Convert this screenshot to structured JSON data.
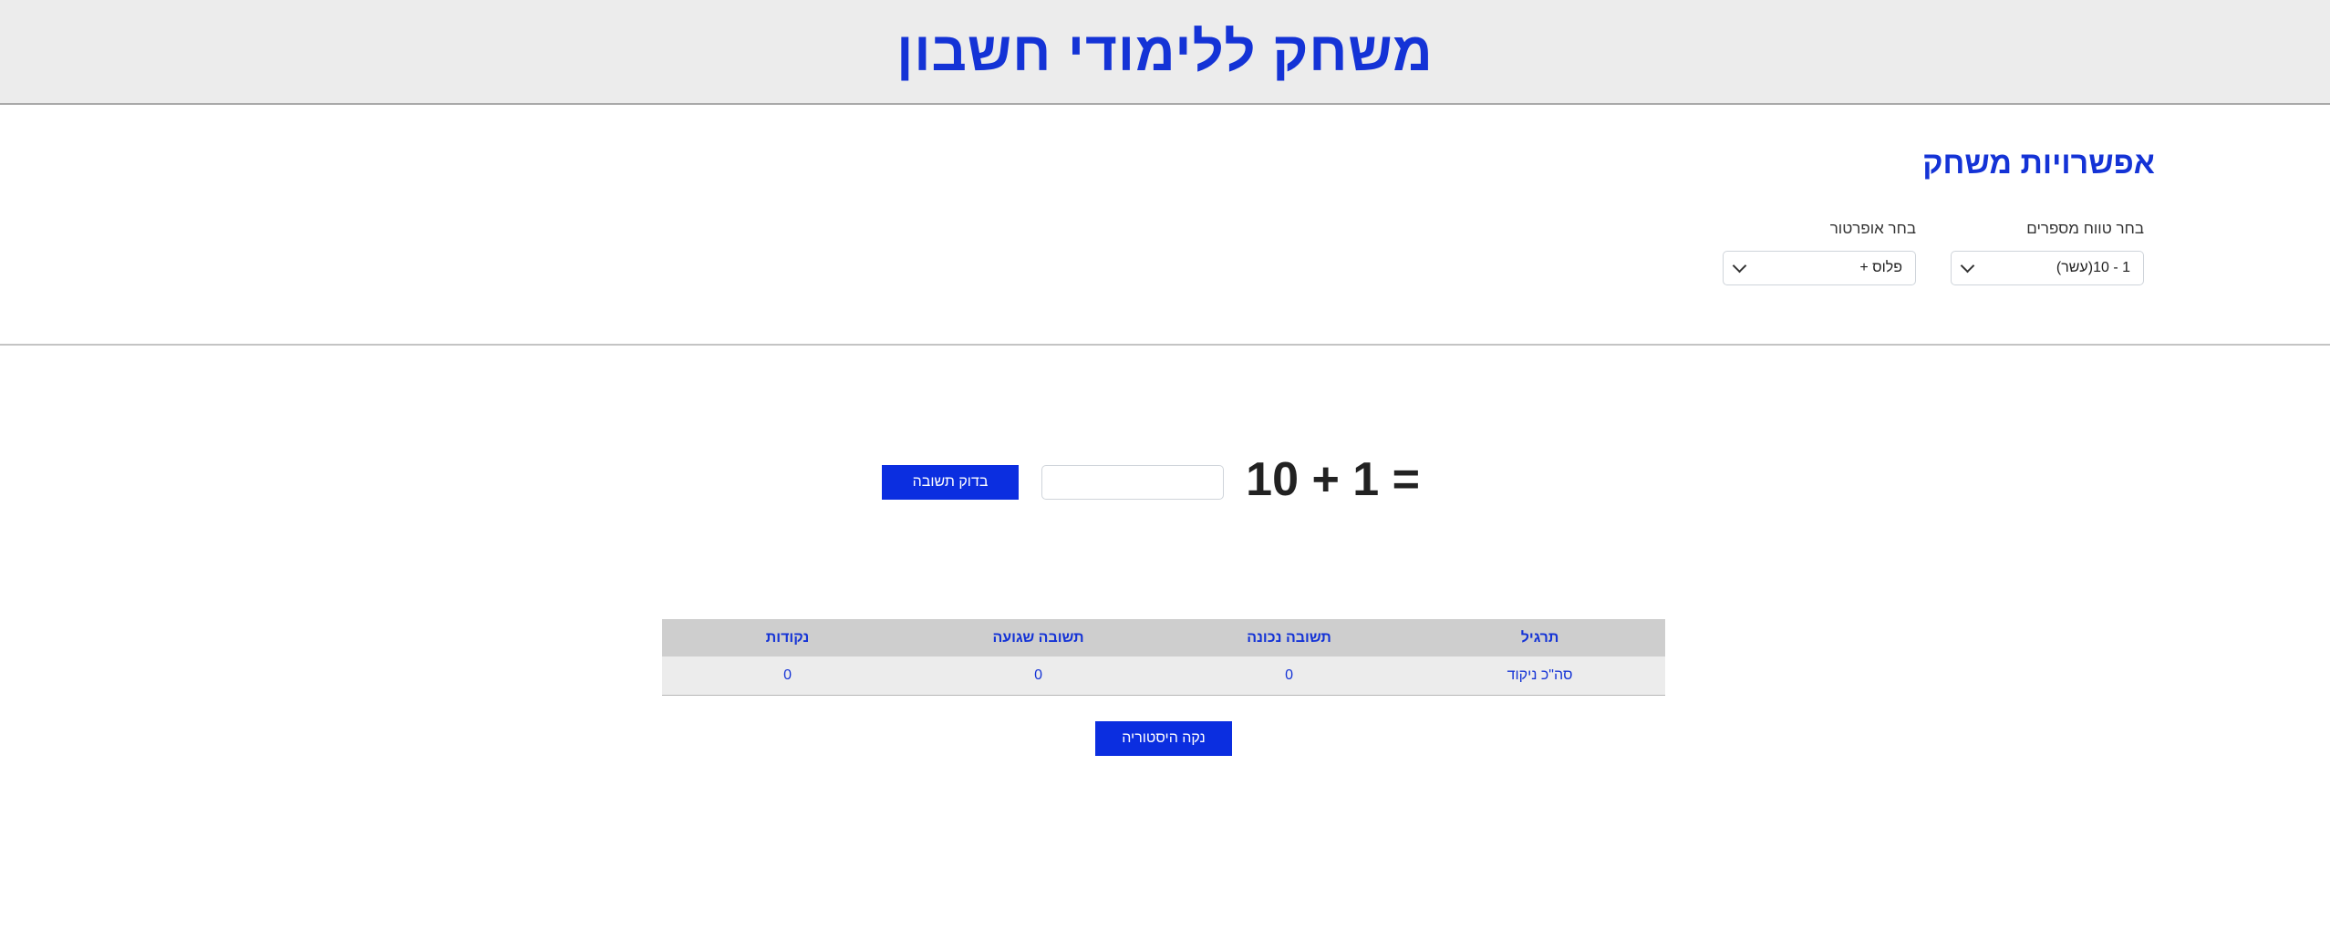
{
  "header": {
    "title": "משחק ללימודי חשבון"
  },
  "options": {
    "title": "אפשרויות משחק",
    "range": {
      "label": "בחר טווח מספרים",
      "selected": "1 - 10(עשר)"
    },
    "operator": {
      "label": "בחר אופרטור",
      "selected": "פלוס +"
    }
  },
  "exercise": {
    "expression": "10 + 1 =",
    "answer_value": "",
    "check_label": "בדוק תשובה"
  },
  "score_table": {
    "headers": [
      "תרגיל",
      "תשובה נכונה",
      "תשובה שגועה",
      "נקודות"
    ],
    "rows": [
      [
        "סה\"כ ניקוד",
        "0",
        "0",
        "0"
      ]
    ]
  },
  "clear_label": "נקה היסטוריה",
  "colors": {
    "accent": "#0b2ee0",
    "heading": "#1433d6"
  }
}
